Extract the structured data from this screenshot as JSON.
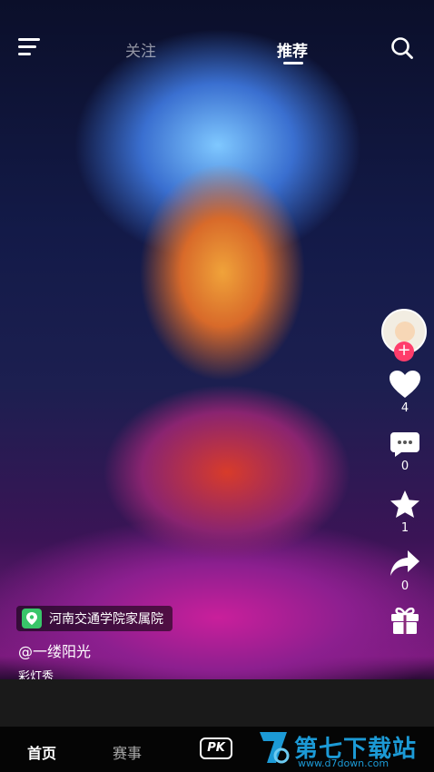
{
  "header": {
    "tabs": [
      {
        "label": "关注",
        "active": false
      },
      {
        "label": "推荐",
        "active": true
      }
    ],
    "menu_icon": "hamburger-menu-icon",
    "search_icon": "search-icon"
  },
  "creator": {
    "avatar": "avatar-icon",
    "follow_symbol": "+"
  },
  "actions": [
    {
      "name": "like",
      "icon": "heart-icon",
      "count": "4"
    },
    {
      "name": "comment",
      "icon": "comment-icon",
      "count": "0"
    },
    {
      "name": "favorite",
      "icon": "star-icon",
      "count": "1"
    },
    {
      "name": "share",
      "icon": "share-icon",
      "count": "0"
    },
    {
      "name": "gift",
      "icon": "gift-icon"
    }
  ],
  "video": {
    "location": "河南交通学院家属院",
    "author": "@一缕阳光",
    "caption": "彩灯秀"
  },
  "bottom_nav": {
    "items": [
      {
        "label": "首页",
        "active": true
      },
      {
        "label": "赛事",
        "active": false
      },
      {
        "label": "PK",
        "active": false
      }
    ]
  },
  "watermark": {
    "title": "第七下载站",
    "url": "www.d7down.com"
  },
  "colors": {
    "accent_pink": "#ff3d6b",
    "location_green": "#39c56a",
    "watermark_blue": "#1c9ad6"
  }
}
